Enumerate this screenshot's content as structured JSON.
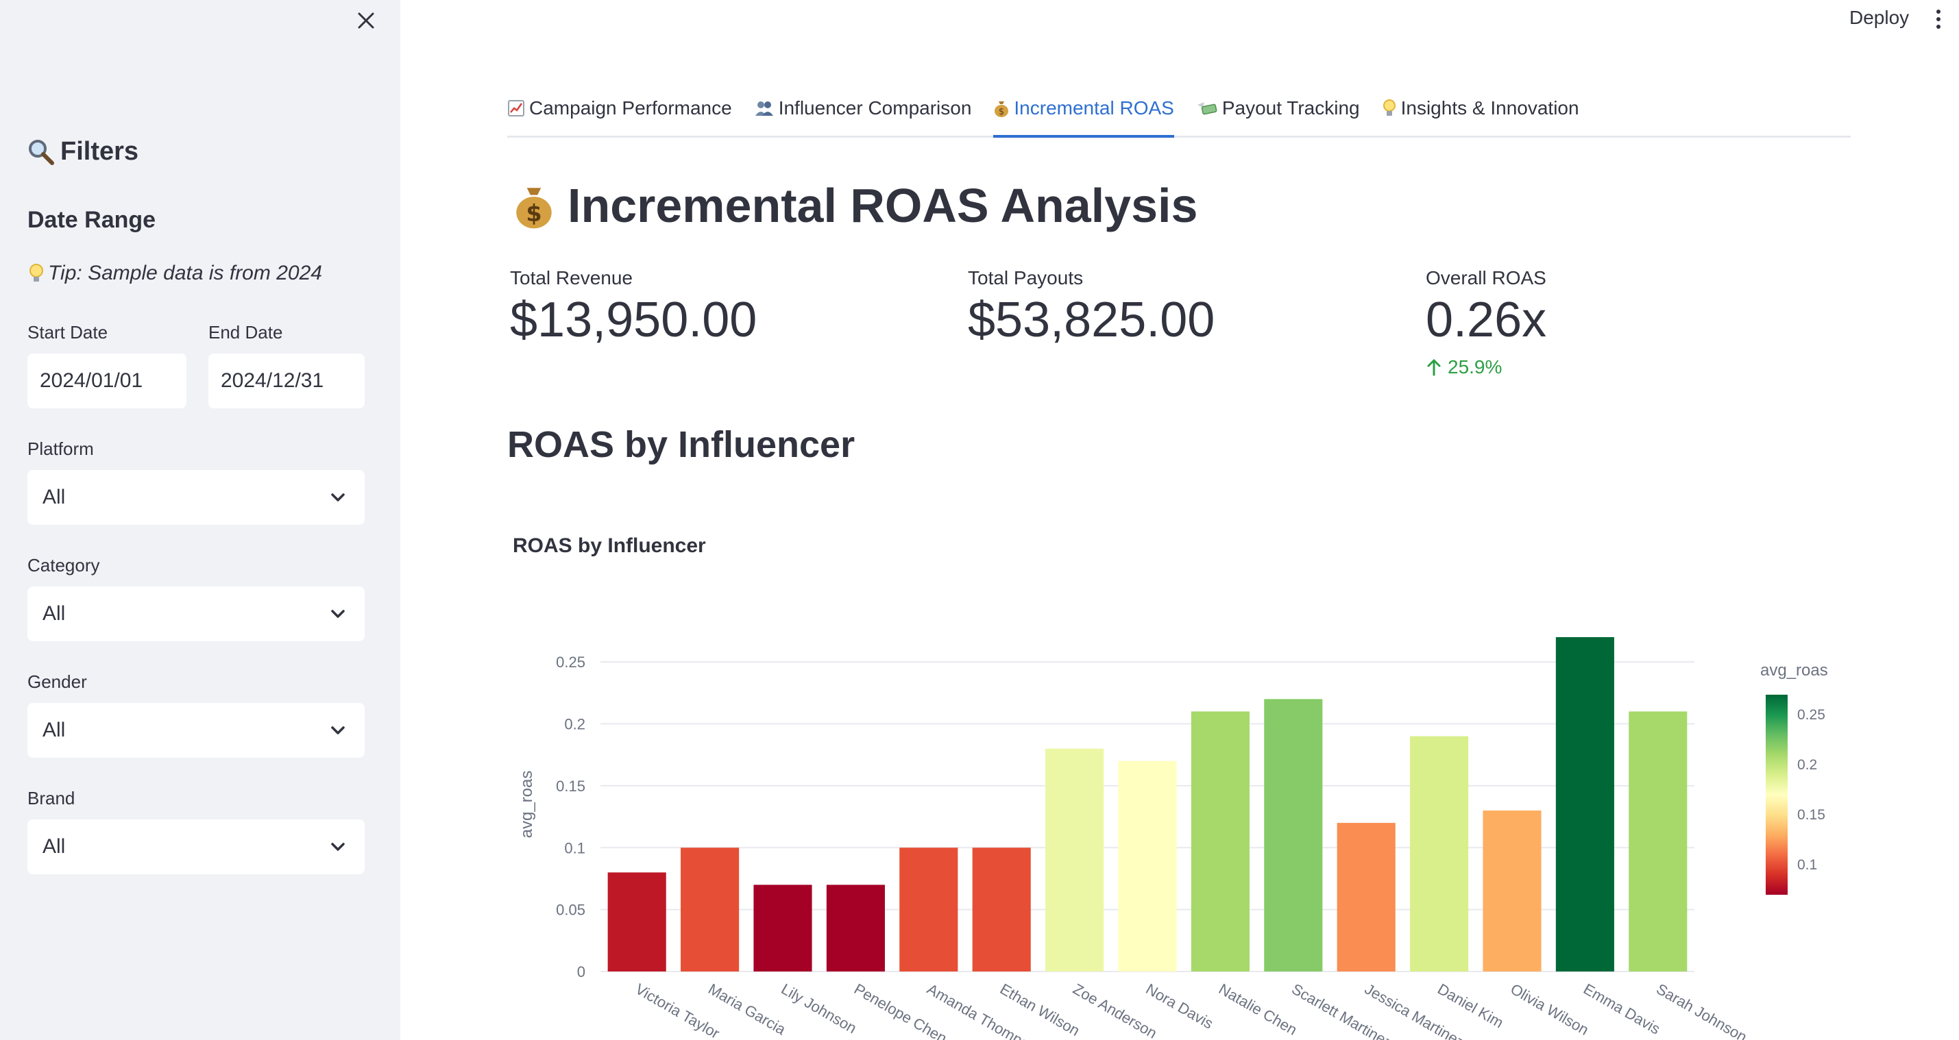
{
  "sidebar": {
    "title": "Filters",
    "date_range_heading": "Date Range",
    "tip": "Tip: Sample data is from 2024",
    "start_date": {
      "label": "Start Date",
      "value": "2024/01/01"
    },
    "end_date": {
      "label": "End Date",
      "value": "2024/12/31"
    },
    "selects": [
      {
        "label": "Platform",
        "value": "All"
      },
      {
        "label": "Category",
        "value": "All"
      },
      {
        "label": "Gender",
        "value": "All"
      },
      {
        "label": "Brand",
        "value": "All"
      }
    ]
  },
  "topbar": {
    "deploy_label": "Deploy"
  },
  "tabs": [
    {
      "icon": "chart-increasing-icon",
      "label": "Campaign Performance",
      "active": false
    },
    {
      "icon": "people-icon",
      "label": "Influencer Comparison",
      "active": false
    },
    {
      "icon": "money-bag-icon",
      "label": "Incremental ROAS",
      "active": true
    },
    {
      "icon": "money-wings-icon",
      "label": "Payout Tracking",
      "active": false
    },
    {
      "icon": "lightbulb-icon",
      "label": "Insights & Innovation",
      "active": false
    }
  ],
  "page": {
    "title": "Incremental ROAS Analysis",
    "metrics": [
      {
        "label": "Total Revenue",
        "value": "$13,950.00"
      },
      {
        "label": "Total Payouts",
        "value": "$53,825.00"
      },
      {
        "label": "Overall ROAS",
        "value": "0.26x",
        "delta": "25.9%"
      }
    ],
    "section_title": "ROAS by Influencer"
  },
  "colors": {
    "accent": "#2e6fd0",
    "delta_positive": "#2e9f45",
    "sidebar_bg": "#f0f2f6"
  },
  "chart_data": {
    "type": "bar",
    "title": "ROAS by Influencer",
    "xlabel": "",
    "ylabel": "avg_roas",
    "ylim": [
      0,
      0.27
    ],
    "yticks": [
      0,
      0.05,
      0.1,
      0.15,
      0.2,
      0.25
    ],
    "ytick_labels": [
      "0",
      "0.05",
      "0.1",
      "0.15",
      "0.2",
      "0.25"
    ],
    "grid": true,
    "categories": [
      "Victoria Taylor",
      "Maria Garcia",
      "Lily Johnson",
      "Penelope Chen",
      "Amanda Thompson",
      "Ethan Wilson",
      "Zoe Anderson",
      "Nora Davis",
      "Natalie Chen",
      "Scarlett Martinez",
      "Jessica Martinez",
      "Daniel Kim",
      "Olivia Wilson",
      "Emma Davis",
      "Sarah Johnson"
    ],
    "values": [
      0.08,
      0.1,
      0.07,
      0.07,
      0.1,
      0.1,
      0.18,
      0.17,
      0.21,
      0.22,
      0.12,
      0.19,
      0.13,
      0.27,
      0.21
    ],
    "colorbar": {
      "title": "avg_roas",
      "position": "right",
      "colorscale": "RdYlGn",
      "range": [
        0.07,
        0.27
      ],
      "ticks": [
        0.1,
        0.15,
        0.2,
        0.25
      ],
      "tick_labels": [
        "0.1",
        "0.15",
        "0.2",
        "0.25"
      ]
    }
  }
}
